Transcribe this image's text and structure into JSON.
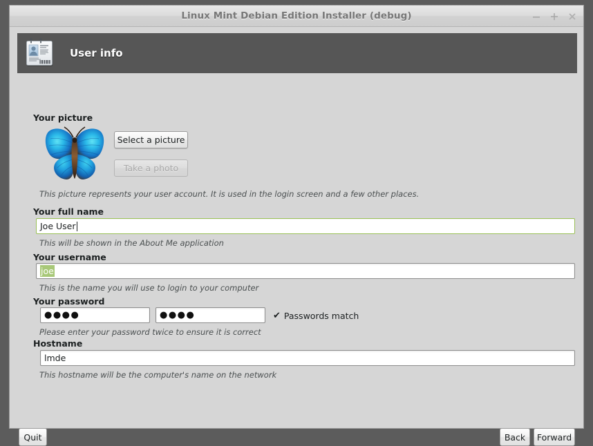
{
  "window": {
    "title": "Linux Mint Debian Edition Installer (debug)",
    "controls": [
      {
        "name": "minimize",
        "glyph": "−"
      },
      {
        "name": "maximize",
        "glyph": "+"
      },
      {
        "name": "close",
        "glyph": "×"
      }
    ],
    "colors": {
      "desktop": "#5c5c5c",
      "window_bg": "#d6d6d6",
      "header_banner": "#565656",
      "focus_green": "#9ac157",
      "selection_green": "#a8c878",
      "title_text": "#777777"
    }
  },
  "header": {
    "title": "User info",
    "icon": "id-card-icon"
  },
  "picture": {
    "label": "Your picture",
    "image": "butterfly-avatar",
    "select_button": "Select a picture",
    "photo_button": "Take a photo",
    "photo_button_disabled": true,
    "hint": "This picture represents your user account. It is used in the login screen and a few other places."
  },
  "fullname": {
    "label": "Your full name",
    "value": "Joe User",
    "focused": true,
    "hint": "This will be shown in the About Me application"
  },
  "username": {
    "label": "Your username",
    "value": "joe",
    "selected": true,
    "hint": "This is the name you will use to login to your computer"
  },
  "password": {
    "label": "Your password",
    "value": "●●●●",
    "confirm_value": "●●●●",
    "match_icon": "check-icon",
    "match_text": "Passwords match",
    "hint": "Please enter your password twice to ensure it is correct"
  },
  "hostname": {
    "label": "Hostname",
    "value": "lmde",
    "hint": "This hostname will be the computer's name on the network"
  },
  "footer": {
    "quit": "Quit",
    "back": "Back",
    "forward": "Forward"
  }
}
